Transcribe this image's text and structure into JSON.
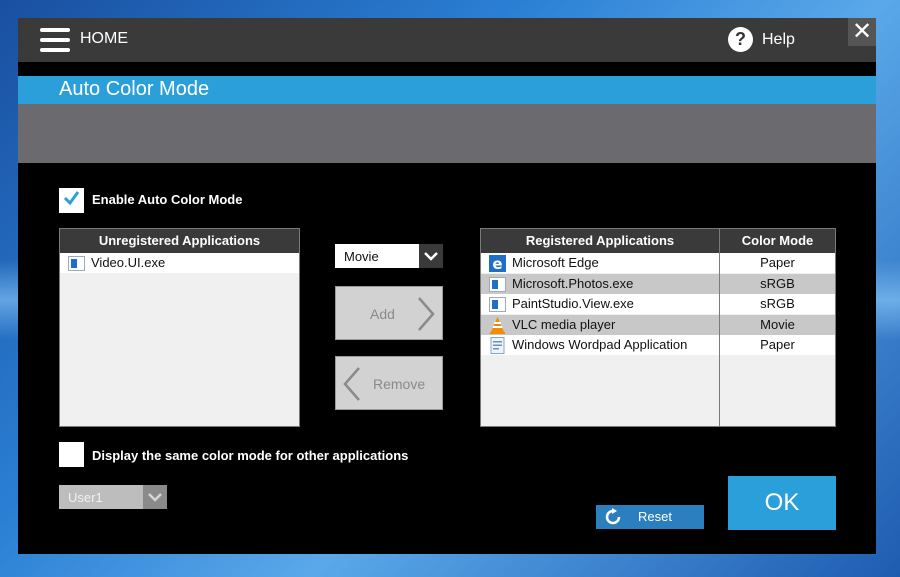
{
  "header": {
    "menu_icon": "hamburger-menu-icon",
    "home_label": "HOME",
    "help_icon": "question-mark-icon",
    "help_label": "Help",
    "close_glyph": "✕"
  },
  "page": {
    "title": "Auto Color Mode"
  },
  "enable_auto": {
    "label": "Enable Auto Color Mode",
    "checked": true
  },
  "unregistered": {
    "header": "Unregistered Applications",
    "items": [
      {
        "name": "Video.UI.exe",
        "icon": "window-app-icon"
      }
    ]
  },
  "mode_select": {
    "value": "Movie"
  },
  "buttons": {
    "add": "Add",
    "remove": "Remove",
    "reset": "Reset",
    "ok": "OK"
  },
  "registered": {
    "header_app": "Registered Applications",
    "header_mode": "Color Mode",
    "rows": [
      {
        "name": "Microsoft Edge",
        "mode": "Paper",
        "icon": "edge-icon"
      },
      {
        "name": "Microsoft.Photos.exe",
        "mode": "sRGB",
        "icon": "window-app-icon"
      },
      {
        "name": "PaintStudio.View.exe",
        "mode": "sRGB",
        "icon": "window-app-icon"
      },
      {
        "name": "VLC media player",
        "mode": "Movie",
        "icon": "vlc-cone-icon"
      },
      {
        "name": "Windows Wordpad Application",
        "mode": "Paper",
        "icon": "wordpad-icon"
      }
    ]
  },
  "same_mode": {
    "label": "Display the same color mode for other applications",
    "checked": false
  },
  "user_select": {
    "value": "User1"
  },
  "colors": {
    "accent": "#2b9fd9",
    "topbar": "#3a3a3a",
    "band": "#6b6b6f"
  }
}
